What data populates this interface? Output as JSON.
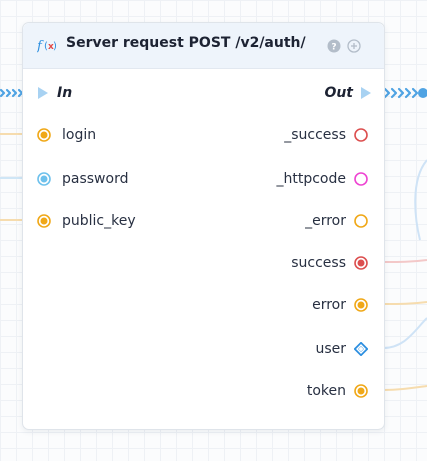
{
  "node": {
    "icon": "function-icon",
    "title": "Server request POST /v2/auth/",
    "header_icons": [
      "help-icon",
      "add-pin-icon"
    ]
  },
  "exec": {
    "in_label": "In",
    "out_label": "Out"
  },
  "inputs": [
    {
      "label": "login",
      "color": "#f0a818"
    },
    {
      "label": "password",
      "color": "#6ec1ec"
    },
    {
      "label": "public_key",
      "color": "#f0a818"
    }
  ],
  "outputs": [
    {
      "label": "_success",
      "color": "#dc4f4f",
      "style": "hollow"
    },
    {
      "label": "_httpcode",
      "color": "#ee44d2",
      "style": "hollow"
    },
    {
      "label": "_error",
      "color": "#f0a818",
      "style": "hollow"
    },
    {
      "label": "success",
      "color": "#dc4f4f",
      "style": "filled"
    },
    {
      "label": "error",
      "color": "#f0a818",
      "style": "filled"
    },
    {
      "label": "user",
      "color": "#2d8fe0",
      "style": "struct"
    },
    {
      "label": "token",
      "color": "#f0a818",
      "style": "filled"
    }
  ],
  "colors": {
    "exec_arrow": "#a8d2f2",
    "exec_wire": "#4fa3e3"
  }
}
